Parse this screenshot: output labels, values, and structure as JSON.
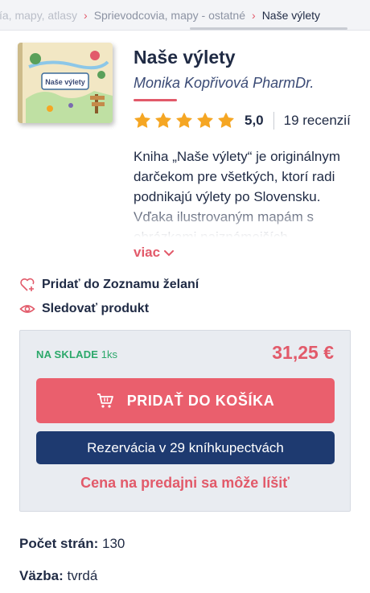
{
  "breadcrumb": {
    "items": [
      "vía, mapy, atlasy",
      "Sprievodcovia, mapy - ostatné",
      "Naše výlety"
    ]
  },
  "product": {
    "title": "Naše výlety",
    "author": "Monika Kopřivová PharmDr.",
    "cover_title": "Naše výlety",
    "rating": {
      "value": "5,0",
      "stars": 5,
      "max_stars": 5,
      "reviews": "19 recenzií"
    },
    "description": "Kniha „Naše výlety“ je originálnym darčekom pre všetkých, ktorí radi podnikajú výlety po Slovensku. Vďaka ilustrovaným mapám s obrázkami najznámejších",
    "more_label": "viac"
  },
  "actions": {
    "wishlist_label": "Pridať do Zoznamu želaní",
    "watch_label": "Sledovať produkt"
  },
  "buybox": {
    "stock_label": "NA SKLADE",
    "stock_count": "1ks",
    "price": "31,25 €",
    "cart_button": "PRIDAŤ DO KOŠÍKA",
    "reserve_button": "Rezervácia v 29 kníhkupectvách",
    "store_note": "Cena na predajni sa môže líšiť"
  },
  "specs": [
    {
      "label": "Počet strán:",
      "value": "130"
    },
    {
      "label": "Väzba:",
      "value": "tvrdá"
    }
  ],
  "colors": {
    "accent": "#e25a6a",
    "navy": "#1e3a70",
    "star": "#f5a623",
    "in_stock": "#2ba86a",
    "buybox_bg": "#e9ecf1"
  },
  "icons": [
    "chevron-right-icon",
    "star-icon",
    "chevron-down-icon",
    "heart-plus-icon",
    "eye-icon",
    "cart-icon"
  ]
}
